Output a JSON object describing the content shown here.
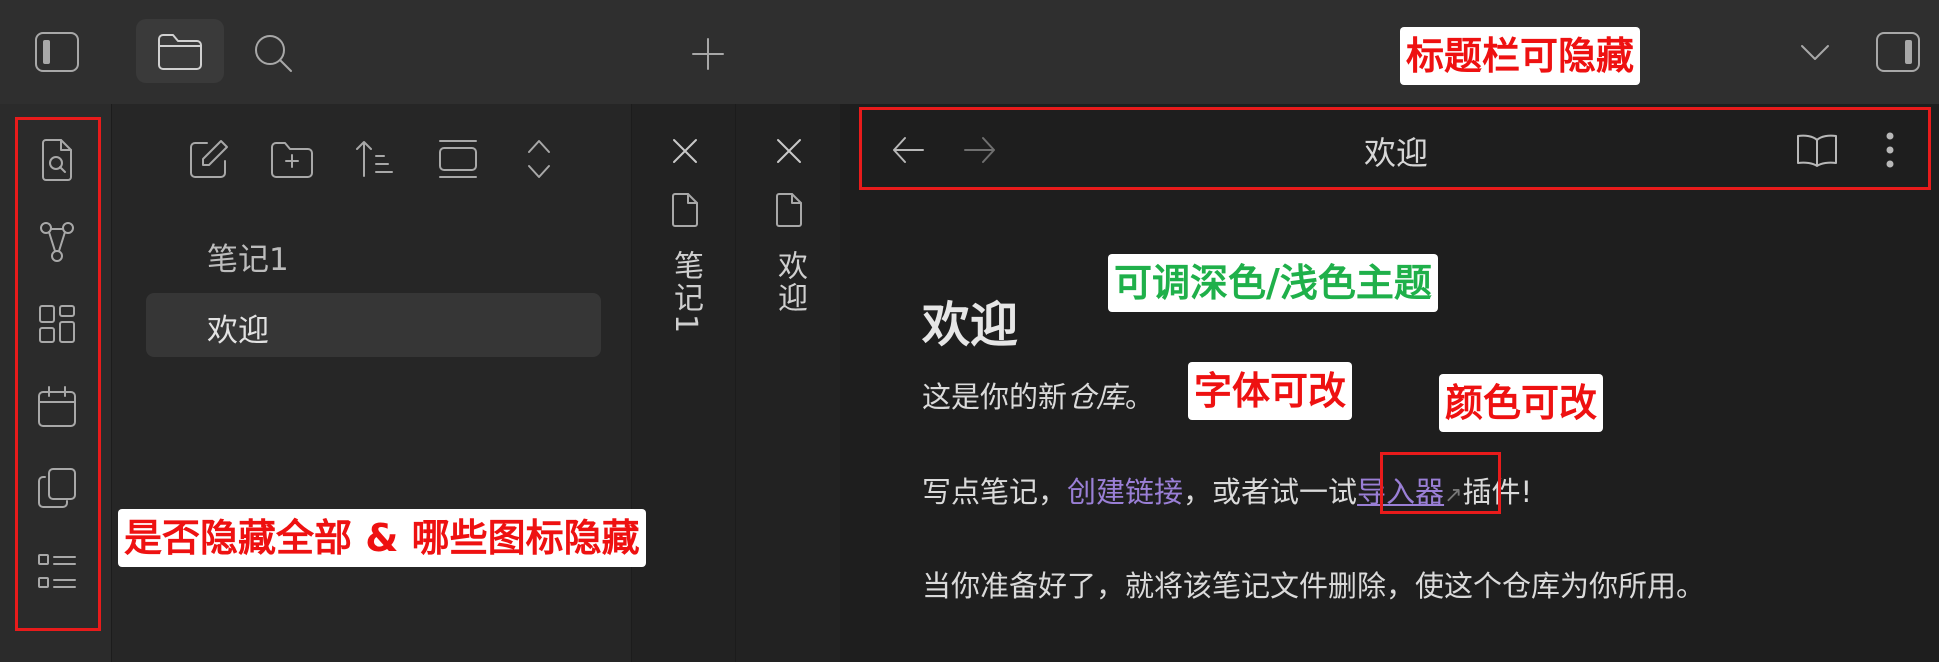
{
  "topbar": {
    "icons": [
      "sidebar-left-toggle-icon",
      "folder-icon",
      "search-icon",
      "plus-icon",
      "chevron-down-icon",
      "sidebar-right-toggle-icon"
    ]
  },
  "ribbon": {
    "icons": [
      "file-search-icon",
      "graph-icon",
      "layout-grid-icon",
      "calendar-icon",
      "copy-icon",
      "list-icon"
    ]
  },
  "explorer": {
    "toolbar_icons": [
      "new-note-icon",
      "new-folder-icon",
      "sort-icon",
      "collapse-view-icon",
      "expand-collapse-icon"
    ],
    "files": [
      {
        "label": "笔记1",
        "active": false
      },
      {
        "label": "欢迎",
        "active": true
      }
    ]
  },
  "stacked_tabs": [
    {
      "title": "笔记1"
    },
    {
      "title": "欢迎"
    }
  ],
  "view_header": {
    "title": "欢迎",
    "back_icon": "arrow-left-icon",
    "forward_icon": "arrow-right-icon",
    "reading_icon": "book-open-icon",
    "more_icon": "more-vertical-icon"
  },
  "document": {
    "heading": "欢迎",
    "p1_prefix": "这是你的新",
    "p1_em": "仓库",
    "p1_suffix": "。",
    "p2_prefix": "写点笔记，",
    "p2_link": "创建链接",
    "p2_middle": "，或者试一试",
    "p2_external_link": "导入器",
    "p2_suffix": "插件!",
    "p3": "当你准备好了，就将该笔记文件删除，使这个仓库为你所用。"
  },
  "annotations": {
    "titlebar": "标题栏可隐藏",
    "theme": "可调深色/浅色主题",
    "font": "字体可改",
    "color": "颜色可改",
    "ribbon": "是否隐藏全部 & 哪些图标隐藏"
  },
  "colors": {
    "annotation_red": "#ee1111",
    "annotation_green": "#1fb04a",
    "link_purple": "#9a7fd6",
    "highlight_box": "#e81b1b"
  }
}
